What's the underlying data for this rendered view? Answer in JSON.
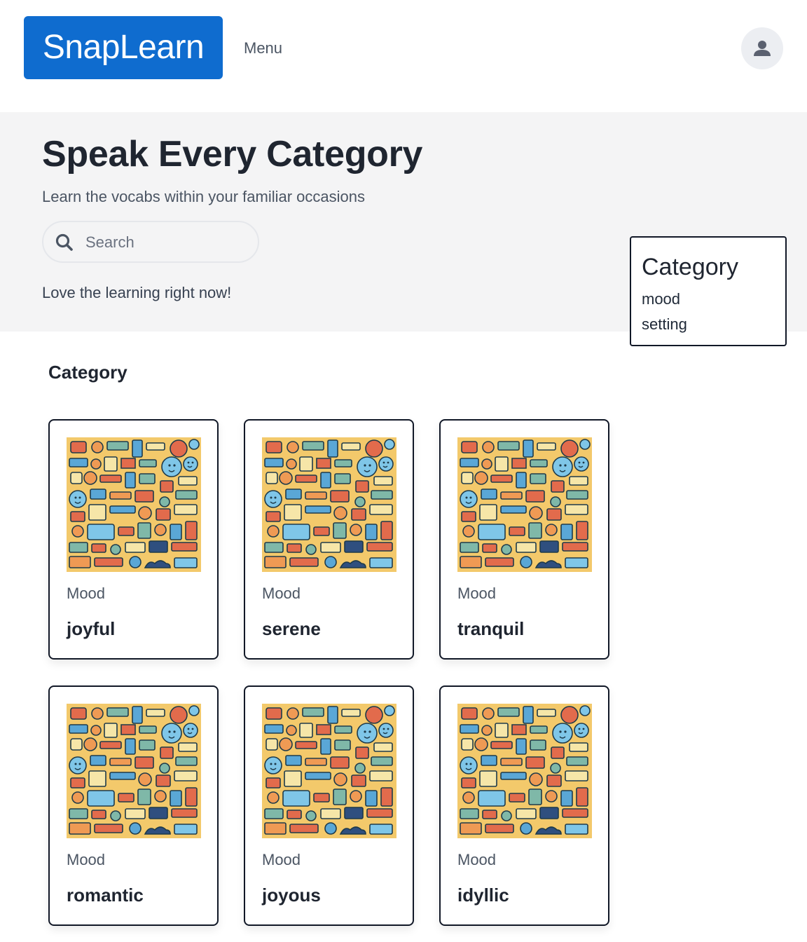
{
  "header": {
    "logo": "SnapLearn",
    "menu_label": "Menu",
    "avatar_icon": "user-icon"
  },
  "hero": {
    "title": "Speak Every Category",
    "subtitle": "Learn the vocabs within your familiar occasions",
    "search_placeholder": "Search",
    "tagline": "Love the learning right now!"
  },
  "category_dropdown": {
    "title": "Category",
    "items": [
      "mood",
      "setting"
    ]
  },
  "section_heading": "Category",
  "cards": [
    {
      "category": "Mood",
      "word": "joyful"
    },
    {
      "category": "Mood",
      "word": "serene"
    },
    {
      "category": "Mood",
      "word": "tranquil"
    },
    {
      "category": "Mood",
      "word": "romantic"
    },
    {
      "category": "Mood",
      "word": "joyous"
    },
    {
      "category": "Mood",
      "word": "idyllic"
    }
  ],
  "colors": {
    "brand": "#0f6ccf",
    "hero_bg": "#f4f4f5",
    "illustration_bg": "#f3c96b"
  }
}
